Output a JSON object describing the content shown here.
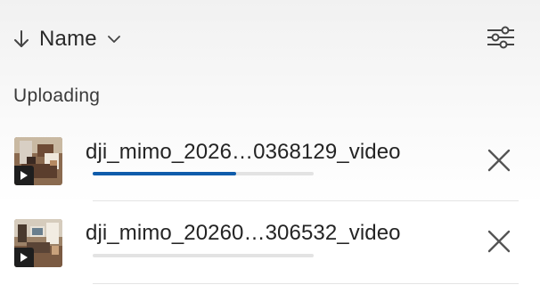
{
  "sort": {
    "label": "Name",
    "direction": "descending",
    "icon": "arrow-down-icon",
    "menu_icon": "chevron-down-icon"
  },
  "toolbar": {
    "filter_icon": "sliders-icon"
  },
  "section": {
    "title": "Uploading"
  },
  "uploads": [
    {
      "name": "dji_mimo_2026…0368129_video",
      "type": "video",
      "progress": 0.65,
      "cancel_icon": "close-icon"
    },
    {
      "name": "dji_mimo_20260…306532_video",
      "type": "video",
      "progress": 0.0,
      "cancel_icon": "close-icon"
    }
  ],
  "colors": {
    "progress_fill": "#0f5cab",
    "progress_track": "#e3e3e3",
    "text_primary": "#242424",
    "icon": "#555555"
  }
}
